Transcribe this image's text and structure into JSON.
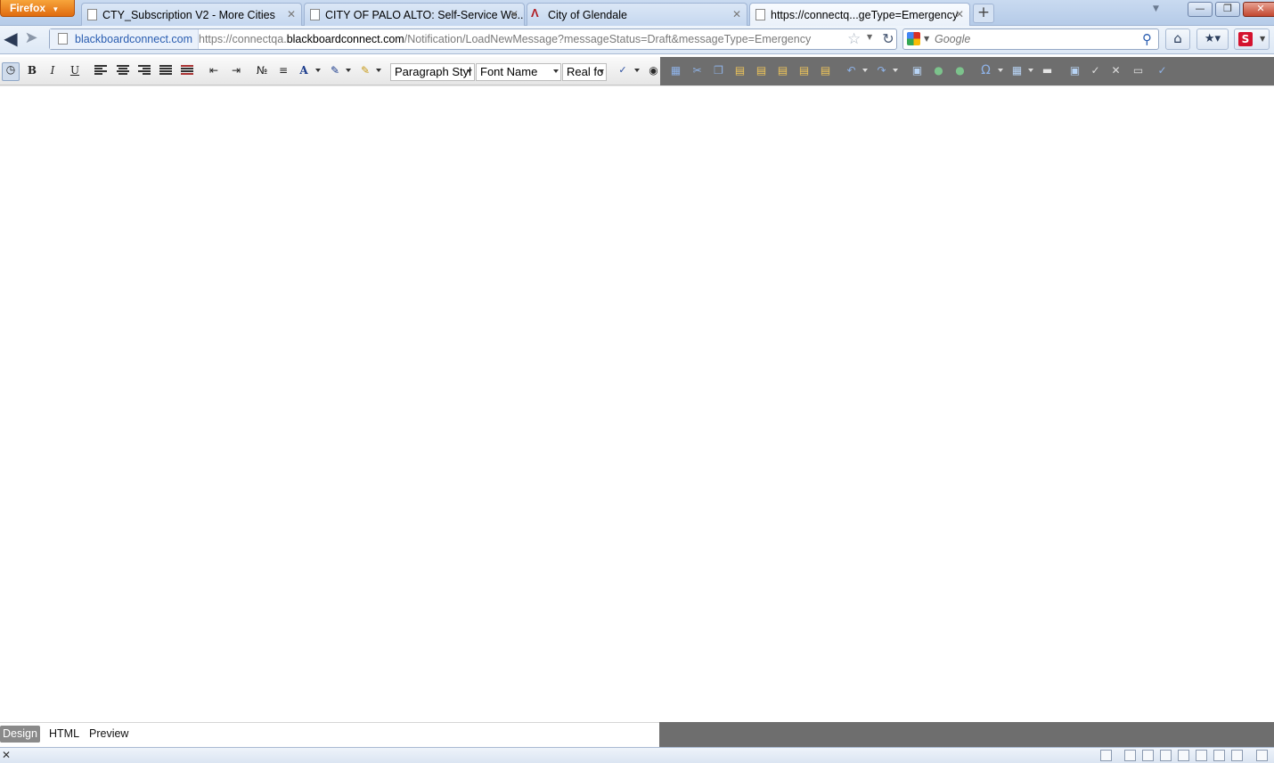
{
  "browser": {
    "menu_label": "Firefox",
    "tabs": [
      {
        "title": "CTY_Subscription V2 - More Cities",
        "favicon": "page-icon"
      },
      {
        "title": "CITY OF PALO ALTO: Self-Service We...",
        "favicon": "page-icon"
      },
      {
        "title": "City of Glendale",
        "favicon": "glendale-logo-icon"
      },
      {
        "title": "https://connectq...geType=Emergency",
        "favicon": "page-icon",
        "active": true
      }
    ],
    "new_tab_label": "+",
    "site_identity": "blackboardconnect.com",
    "url": {
      "prefix": "https://connectqa.",
      "domain": "blackboardconnect.com",
      "path": "/Notification/LoadNewMessage?messageStatus=Draft&messageType=Emergency"
    },
    "search": {
      "engine": "Google",
      "placeholder": "Google",
      "value": ""
    }
  },
  "editor": {
    "toolbar": {
      "paragraph_style": "Paragraph Styl",
      "font_name": "Font Name",
      "font_size": "Real fo"
    },
    "modes": [
      {
        "label": "Design",
        "active": true
      },
      {
        "label": "HTML",
        "active": false
      },
      {
        "label": "Preview",
        "active": false
      }
    ],
    "content": ""
  },
  "colors": {
    "firefox_button": "#e06b0f",
    "toolbar_dark": "#6e6e6e",
    "link_blue": "#2a5db0"
  }
}
